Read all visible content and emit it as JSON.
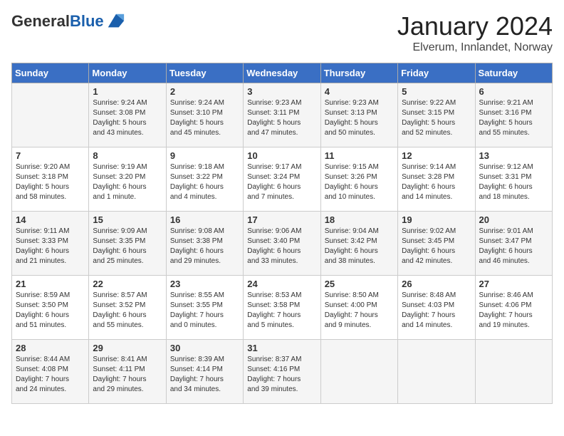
{
  "header": {
    "logo_general": "General",
    "logo_blue": "Blue",
    "month_year": "January 2024",
    "location": "Elverum, Innlandet, Norway"
  },
  "days_of_week": [
    "Sunday",
    "Monday",
    "Tuesday",
    "Wednesday",
    "Thursday",
    "Friday",
    "Saturday"
  ],
  "weeks": [
    [
      {
        "day": "",
        "info": ""
      },
      {
        "day": "1",
        "info": "Sunrise: 9:24 AM\nSunset: 3:08 PM\nDaylight: 5 hours\nand 43 minutes."
      },
      {
        "day": "2",
        "info": "Sunrise: 9:24 AM\nSunset: 3:10 PM\nDaylight: 5 hours\nand 45 minutes."
      },
      {
        "day": "3",
        "info": "Sunrise: 9:23 AM\nSunset: 3:11 PM\nDaylight: 5 hours\nand 47 minutes."
      },
      {
        "day": "4",
        "info": "Sunrise: 9:23 AM\nSunset: 3:13 PM\nDaylight: 5 hours\nand 50 minutes."
      },
      {
        "day": "5",
        "info": "Sunrise: 9:22 AM\nSunset: 3:15 PM\nDaylight: 5 hours\nand 52 minutes."
      },
      {
        "day": "6",
        "info": "Sunrise: 9:21 AM\nSunset: 3:16 PM\nDaylight: 5 hours\nand 55 minutes."
      }
    ],
    [
      {
        "day": "7",
        "info": "Sunrise: 9:20 AM\nSunset: 3:18 PM\nDaylight: 5 hours\nand 58 minutes."
      },
      {
        "day": "8",
        "info": "Sunrise: 9:19 AM\nSunset: 3:20 PM\nDaylight: 6 hours\nand 1 minute."
      },
      {
        "day": "9",
        "info": "Sunrise: 9:18 AM\nSunset: 3:22 PM\nDaylight: 6 hours\nand 4 minutes."
      },
      {
        "day": "10",
        "info": "Sunrise: 9:17 AM\nSunset: 3:24 PM\nDaylight: 6 hours\nand 7 minutes."
      },
      {
        "day": "11",
        "info": "Sunrise: 9:15 AM\nSunset: 3:26 PM\nDaylight: 6 hours\nand 10 minutes."
      },
      {
        "day": "12",
        "info": "Sunrise: 9:14 AM\nSunset: 3:28 PM\nDaylight: 6 hours\nand 14 minutes."
      },
      {
        "day": "13",
        "info": "Sunrise: 9:12 AM\nSunset: 3:31 PM\nDaylight: 6 hours\nand 18 minutes."
      }
    ],
    [
      {
        "day": "14",
        "info": "Sunrise: 9:11 AM\nSunset: 3:33 PM\nDaylight: 6 hours\nand 21 minutes."
      },
      {
        "day": "15",
        "info": "Sunrise: 9:09 AM\nSunset: 3:35 PM\nDaylight: 6 hours\nand 25 minutes."
      },
      {
        "day": "16",
        "info": "Sunrise: 9:08 AM\nSunset: 3:38 PM\nDaylight: 6 hours\nand 29 minutes."
      },
      {
        "day": "17",
        "info": "Sunrise: 9:06 AM\nSunset: 3:40 PM\nDaylight: 6 hours\nand 33 minutes."
      },
      {
        "day": "18",
        "info": "Sunrise: 9:04 AM\nSunset: 3:42 PM\nDaylight: 6 hours\nand 38 minutes."
      },
      {
        "day": "19",
        "info": "Sunrise: 9:02 AM\nSunset: 3:45 PM\nDaylight: 6 hours\nand 42 minutes."
      },
      {
        "day": "20",
        "info": "Sunrise: 9:01 AM\nSunset: 3:47 PM\nDaylight: 6 hours\nand 46 minutes."
      }
    ],
    [
      {
        "day": "21",
        "info": "Sunrise: 8:59 AM\nSunset: 3:50 PM\nDaylight: 6 hours\nand 51 minutes."
      },
      {
        "day": "22",
        "info": "Sunrise: 8:57 AM\nSunset: 3:52 PM\nDaylight: 6 hours\nand 55 minutes."
      },
      {
        "day": "23",
        "info": "Sunrise: 8:55 AM\nSunset: 3:55 PM\nDaylight: 7 hours\nand 0 minutes."
      },
      {
        "day": "24",
        "info": "Sunrise: 8:53 AM\nSunset: 3:58 PM\nDaylight: 7 hours\nand 5 minutes."
      },
      {
        "day": "25",
        "info": "Sunrise: 8:50 AM\nSunset: 4:00 PM\nDaylight: 7 hours\nand 9 minutes."
      },
      {
        "day": "26",
        "info": "Sunrise: 8:48 AM\nSunset: 4:03 PM\nDaylight: 7 hours\nand 14 minutes."
      },
      {
        "day": "27",
        "info": "Sunrise: 8:46 AM\nSunset: 4:06 PM\nDaylight: 7 hours\nand 19 minutes."
      }
    ],
    [
      {
        "day": "28",
        "info": "Sunrise: 8:44 AM\nSunset: 4:08 PM\nDaylight: 7 hours\nand 24 minutes."
      },
      {
        "day": "29",
        "info": "Sunrise: 8:41 AM\nSunset: 4:11 PM\nDaylight: 7 hours\nand 29 minutes."
      },
      {
        "day": "30",
        "info": "Sunrise: 8:39 AM\nSunset: 4:14 PM\nDaylight: 7 hours\nand 34 minutes."
      },
      {
        "day": "31",
        "info": "Sunrise: 8:37 AM\nSunset: 4:16 PM\nDaylight: 7 hours\nand 39 minutes."
      },
      {
        "day": "",
        "info": ""
      },
      {
        "day": "",
        "info": ""
      },
      {
        "day": "",
        "info": ""
      }
    ]
  ]
}
